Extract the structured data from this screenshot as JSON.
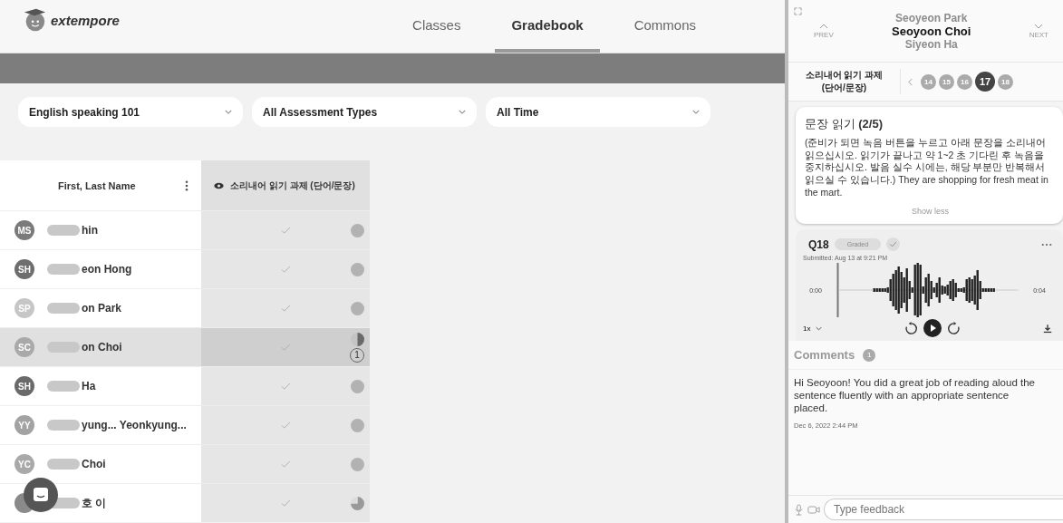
{
  "app": {
    "logo_text": "extempore"
  },
  "nav_tabs": [
    {
      "label": "Classes",
      "selected": false
    },
    {
      "label": "Gradebook",
      "selected": true
    },
    {
      "label": "Commons",
      "selected": false
    }
  ],
  "filters": [
    {
      "value": "English speaking 101"
    },
    {
      "value": "All Assessment Types"
    },
    {
      "value": "All Time"
    }
  ],
  "table": {
    "name_column": "First, Last Name",
    "assignment_column": "소리내어 읽기 과제 (단어/문장)",
    "rows": [
      {
        "initials": "MS",
        "color": "#7a7a7a",
        "name": "hin",
        "selected": false,
        "kind": "full"
      },
      {
        "initials": "SH",
        "color": "#6e6e6e",
        "name": "eon Hong",
        "selected": false,
        "kind": "full"
      },
      {
        "initials": "SP",
        "color": "#c6c6c6",
        "name": "on Park",
        "selected": false,
        "kind": "full"
      },
      {
        "initials": "SC",
        "color": "#a9a9a9",
        "name": "on Choi",
        "selected": true,
        "kind": "half",
        "comments": "1"
      },
      {
        "initials": "SH",
        "color": "#6a6a6a",
        "name": "Ha",
        "selected": false,
        "kind": "full"
      },
      {
        "initials": "YY",
        "color": "#a3a3a3",
        "name": "yung...  Yeonkyung...",
        "selected": false,
        "kind": "full"
      },
      {
        "initials": "YC",
        "color": "#a9a9a9",
        "name": "Choi",
        "selected": false,
        "kind": "full"
      },
      {
        "color": "#8a8a8a",
        "name": "호 이",
        "selected": false,
        "kind": "partial"
      }
    ]
  },
  "panel": {
    "previous_student": "Seoyeon Park",
    "student": "Seoyoon Choi",
    "next_student": "Siyeon Ha",
    "prev_label": "PREV",
    "next_label": "NEXT",
    "assignment": "소리내어 읽기 과제 (단어/문장)",
    "questions": [
      {
        "label": "14",
        "selected": false
      },
      {
        "label": "15",
        "selected": false
      },
      {
        "label": "16",
        "selected": false
      },
      {
        "label": "17",
        "selected": true
      },
      {
        "label": "18",
        "selected": false
      }
    ],
    "prompt_title": "문장 읽기 **(2/5)**",
    "prompt_text": "(준비가 되면 녹음 버튼을 누르고 아래 문장을 소리내어 읽으십시오. 읽기가 끝나고 약 1~2 초 기다린 후 녹음을 중지하십시오. 발음 실수 시에는, 해당 부분만 반복해서 읽으실 수 있습니다.) They are shopping for fresh meat in the mart.",
    "show_less": "Show less",
    "response": {
      "question": "Q18",
      "status": "Graded",
      "submitted": "Submitted: Aug 13 at 9:21 PM",
      "start_time": "0:00",
      "end_time": "0:04",
      "speed": "1x"
    },
    "comments_title": "Comments",
    "comments_count": "1",
    "comments": [
      {
        "text": "Hi Seoyoon! You did a great job of reading aloud the sentence fluently with an appropriate sentence placed.",
        "date": "Dec 6, 2022 2:44 PM"
      }
    ],
    "feedback_placeholder": "Type feedback"
  }
}
